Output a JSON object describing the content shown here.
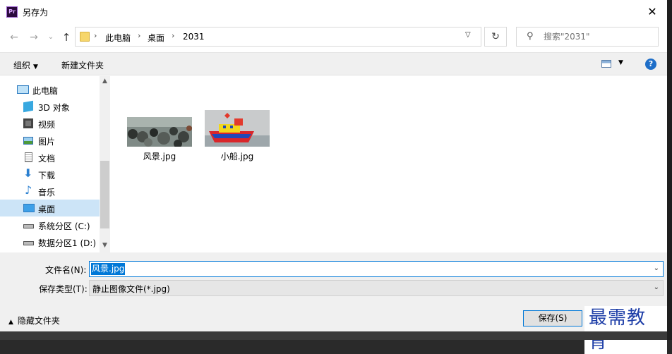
{
  "window": {
    "title": "另存为",
    "app_icon_text": "Pr",
    "close_glyph": "✕"
  },
  "address_bar": {
    "breadcrumbs": [
      "此电脑",
      "桌面",
      "2031"
    ],
    "separator": "›"
  },
  "search": {
    "placeholder": "搜索\"2031\""
  },
  "toolbar": {
    "organize_label": "组织",
    "new_folder_label": "新建文件夹",
    "help_label": "?"
  },
  "nav": {
    "items": [
      {
        "label": "此电脑",
        "icon": "computer-icon"
      },
      {
        "label": "3D 对象",
        "icon": "cube-icon"
      },
      {
        "label": "视频",
        "icon": "video-icon"
      },
      {
        "label": "图片",
        "icon": "picture-icon"
      },
      {
        "label": "文档",
        "icon": "document-icon"
      },
      {
        "label": "下载",
        "icon": "download-icon"
      },
      {
        "label": "音乐",
        "icon": "music-icon"
      },
      {
        "label": "桌面",
        "icon": "desktop-icon",
        "selected": true
      },
      {
        "label": "系统分区 (C:)",
        "icon": "drive-c-icon"
      },
      {
        "label": "数据分区1 (D:)",
        "icon": "drive-d-icon"
      }
    ]
  },
  "files": [
    {
      "name": "风景.jpg",
      "thumb": "crowd-photo"
    },
    {
      "name": "小船.jpg",
      "thumb": "toy-boat-photo"
    }
  ],
  "form": {
    "filename_label": "文件名(N):",
    "filename_value": "风景.jpg",
    "filetype_label": "保存类型(T):",
    "filetype_value": "静止图像文件(*.jpg)"
  },
  "footer": {
    "hide_folders_label": "隐藏文件夹",
    "save_label": "保存(S)"
  },
  "watermark": "最需教育",
  "colors": {
    "accent": "#0078d7",
    "selected_bg": "#cce4f7",
    "watermark": "#1f3fa8"
  }
}
